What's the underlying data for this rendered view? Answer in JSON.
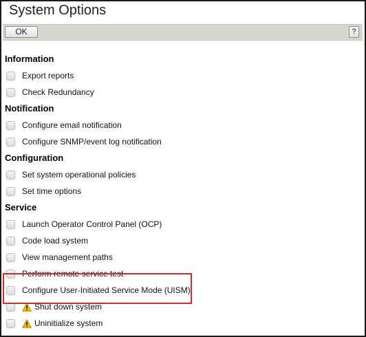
{
  "window": {
    "title": "System Options"
  },
  "toolbar": {
    "ok_label": "OK",
    "help_label": "?"
  },
  "sections": [
    {
      "header": "Information",
      "items": [
        {
          "label": "Export reports",
          "checked": false
        },
        {
          "label": "Check Redundancy",
          "checked": false
        }
      ]
    },
    {
      "header": "Notification",
      "items": [
        {
          "label": "Configure email notification",
          "checked": false
        },
        {
          "label": "Configure SNMP/event log notification",
          "checked": false
        }
      ]
    },
    {
      "header": "Configuration",
      "items": [
        {
          "label": "Set system operational policies",
          "checked": false
        },
        {
          "label": "Set time options",
          "checked": false
        }
      ]
    },
    {
      "header": "Service",
      "items": [
        {
          "label": "Launch Operator Control Panel (OCP)",
          "checked": false
        },
        {
          "label": "Code load system",
          "checked": false
        },
        {
          "label": "View management paths",
          "checked": false
        },
        {
          "label": "Perform remote service test",
          "checked": false,
          "highlighted": true
        },
        {
          "label": "Configure User-Initiated Service Mode (UISM)",
          "checked": false,
          "highlighted": true
        },
        {
          "label": "Shut down system",
          "checked": false,
          "icon": "warning-icon"
        },
        {
          "label": "Uninitialize system",
          "checked": false,
          "icon": "warning-icon"
        }
      ]
    }
  ],
  "colors": {
    "toolbar_bg": "#d9d5cf",
    "highlight_border": "#d42a2a",
    "warning_fill": "#f2c200"
  }
}
